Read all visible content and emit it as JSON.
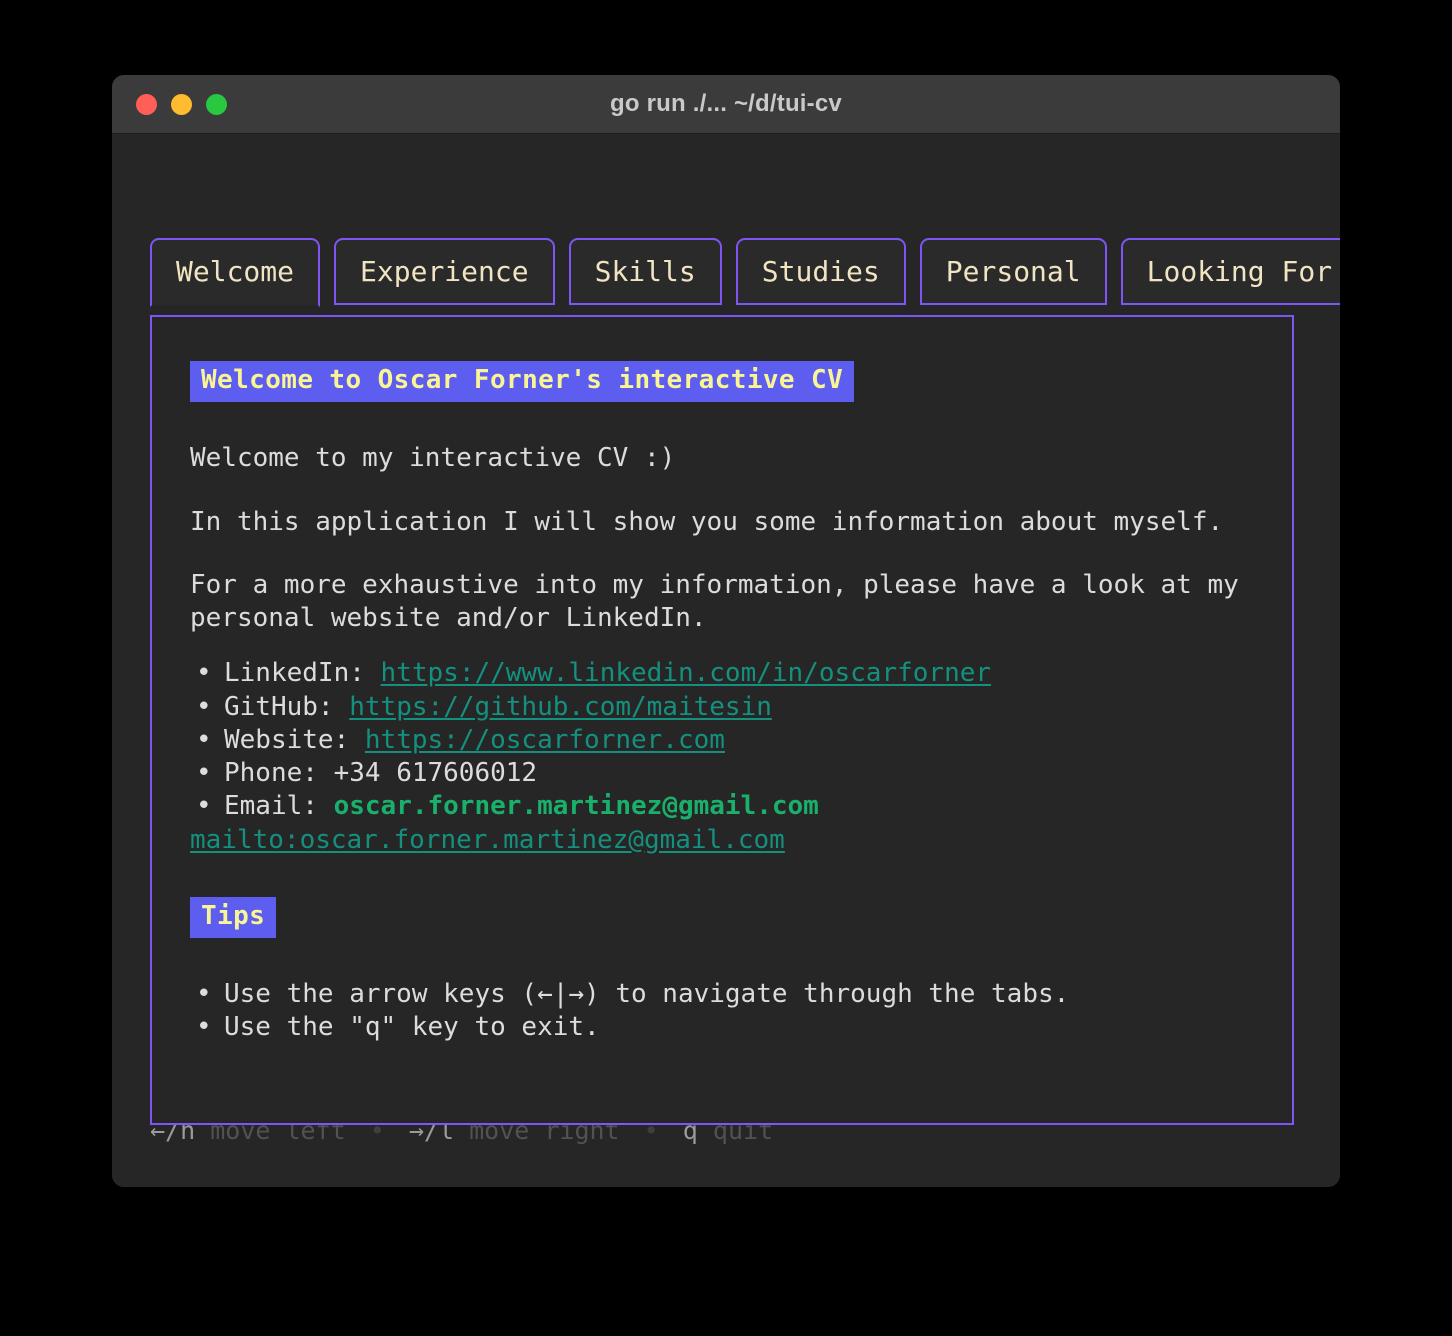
{
  "window": {
    "title": "go run ./... ~/d/tui-cv",
    "traffic_lights": [
      {
        "name": "close",
        "color": "#ff5f57"
      },
      {
        "name": "minimize",
        "color": "#febc2e"
      },
      {
        "name": "zoom",
        "color": "#28c840"
      }
    ],
    "accent_color": "#7d56f4",
    "background": "#262626"
  },
  "tabs": [
    {
      "label": "Welcome",
      "active": true
    },
    {
      "label": "Experience",
      "active": false
    },
    {
      "label": "Skills",
      "active": false
    },
    {
      "label": "Studies",
      "active": false
    },
    {
      "label": "Personal",
      "active": false
    },
    {
      "label": "Looking For",
      "active": false
    }
  ],
  "content": {
    "heading": "Welcome to Oscar Forner's interactive CV",
    "paragraph_1": "Welcome to my interactive CV :)",
    "paragraph_2": "In this application I will show you some information about myself.",
    "paragraph_3": "For a more exhaustive into my information, please have a look at my personal website and/or LinkedIn.",
    "contacts": [
      {
        "label": "LinkedIn:",
        "value": "https://www.linkedin.com/in/oscarforner",
        "style": "link"
      },
      {
        "label": "GitHub:",
        "value": "https://github.com/maitesin",
        "style": "link"
      },
      {
        "label": "Website:",
        "value": "https://oscarforner.com",
        "style": "link"
      },
      {
        "label": "Phone:",
        "value": "+34 617606012",
        "style": "plain"
      },
      {
        "label": "Email:",
        "value": "oscar.forner.martinez@gmail.com",
        "style": "email"
      }
    ],
    "mailto": "mailto:oscar.forner.martinez@gmail.com",
    "tips_heading": "Tips",
    "tips": [
      "Use the arrow keys (←|→) to navigate through the tabs.",
      "Use the \"q\" key to exit."
    ],
    "heading_bg": "#5d5df0",
    "heading_fg": "#faf594",
    "link_color": "#14907f",
    "email_color": "#19b06b"
  },
  "help_bar": {
    "items": [
      {
        "key": "←/h",
        "desc": "move left"
      },
      {
        "key": "→/l",
        "desc": "move right"
      },
      {
        "key": "q",
        "desc": "quit"
      }
    ],
    "separator": "•"
  }
}
